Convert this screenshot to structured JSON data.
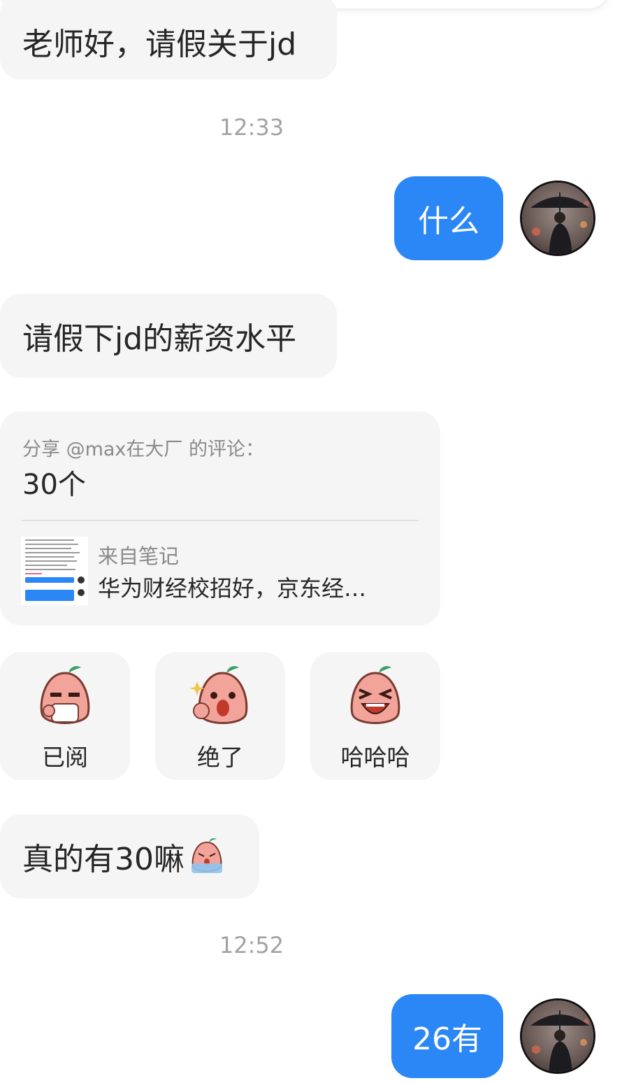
{
  "messages": {
    "m1": "老师好，请假关于jd",
    "time1": "12:33",
    "m2": "什么",
    "m3": "请假下jd的薪资水平",
    "share": {
      "header": "分享 @max在大厂 的评论：",
      "body": "30个",
      "note_source": "来自笔记",
      "note_title": "华为财经校招好，京东经…"
    },
    "reactions": [
      {
        "label": "已阅",
        "icon": "read-emoji-icon"
      },
      {
        "label": "绝了",
        "icon": "amazing-emoji-icon"
      },
      {
        "label": "哈哈哈",
        "icon": "laugh-emoji-icon"
      }
    ],
    "m4": "真的有30嘛",
    "time2": "12:52",
    "m5": "26有"
  },
  "colors": {
    "accent": "#2b87f6",
    "incoming_bg": "#f5f5f5",
    "timestamp": "#a2a2a2"
  }
}
